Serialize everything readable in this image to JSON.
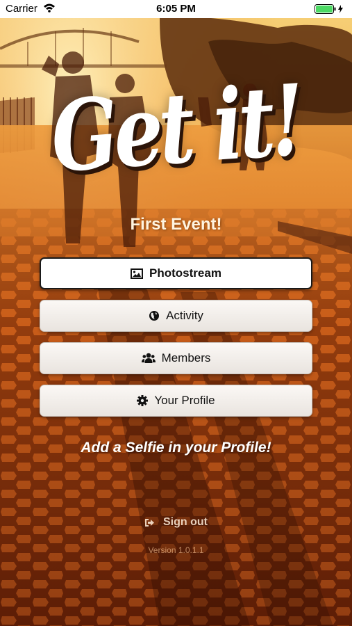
{
  "status_bar": {
    "carrier": "Carrier",
    "time": "6:05 PM",
    "battery_color": "#4cd964"
  },
  "logo": {
    "text": "Get it!"
  },
  "event": {
    "title": "First Event!"
  },
  "menu": [
    {
      "label": "Photostream",
      "icon": "image-icon"
    },
    {
      "label": "Activity",
      "icon": "globe-icon"
    },
    {
      "label": "Members",
      "icon": "users-icon"
    },
    {
      "label": "Your Profile",
      "icon": "gear-icon"
    }
  ],
  "hint": "Add a Selfie in your Profile!",
  "signout": {
    "label": "Sign out",
    "icon": "sign-out-icon"
  },
  "version": "Version 1.0.1.1",
  "colors": {
    "sunset_top": "#f3c35d",
    "sunset_mid": "#d9781c",
    "pavement": "#a8420e"
  }
}
